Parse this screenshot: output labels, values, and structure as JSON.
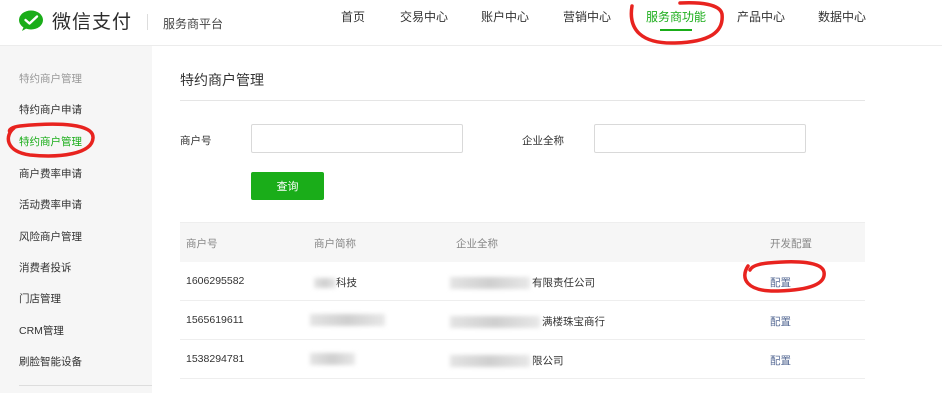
{
  "header": {
    "logo_text": "微信支付",
    "platform_name": "服务商平台",
    "nav": [
      "首页",
      "交易中心",
      "账户中心",
      "营销中心",
      "服务商功能",
      "产品中心",
      "数据中心"
    ],
    "active_nav": "服务商功能"
  },
  "sidebar": {
    "section_title": "特约商户管理",
    "items": [
      "特约商户申请",
      "特约商户管理",
      "商户费率申请",
      "活动费率申请",
      "风险商户管理",
      "消费者投诉",
      "门店管理",
      "CRM管理",
      "刷脸智能设备"
    ],
    "active_item": "特约商户管理"
  },
  "main": {
    "page_title": "特约商户管理",
    "filters": {
      "merchant_no_label": "商户号",
      "merchant_no_value": "",
      "company_name_label": "企业全称",
      "company_name_value": ""
    },
    "query_button": "查询",
    "table": {
      "headers": [
        "商户号",
        "商户简称",
        "企业全称",
        "开发配置"
      ],
      "rows": [
        {
          "merchant_no": "1606295582",
          "short_name": "科技",
          "full_name": "有限责任公司",
          "action": "配置"
        },
        {
          "merchant_no": "1565619611",
          "short_name": "",
          "full_name": "满楼珠宝商行",
          "action": "配置"
        },
        {
          "merchant_no": "1538294781",
          "short_name": "",
          "full_name": "限公司",
          "action": "配置"
        }
      ]
    }
  },
  "colors": {
    "brand_green": "#1aad19",
    "link_blue": "#576b95",
    "annotation_red": "#e8231f"
  }
}
